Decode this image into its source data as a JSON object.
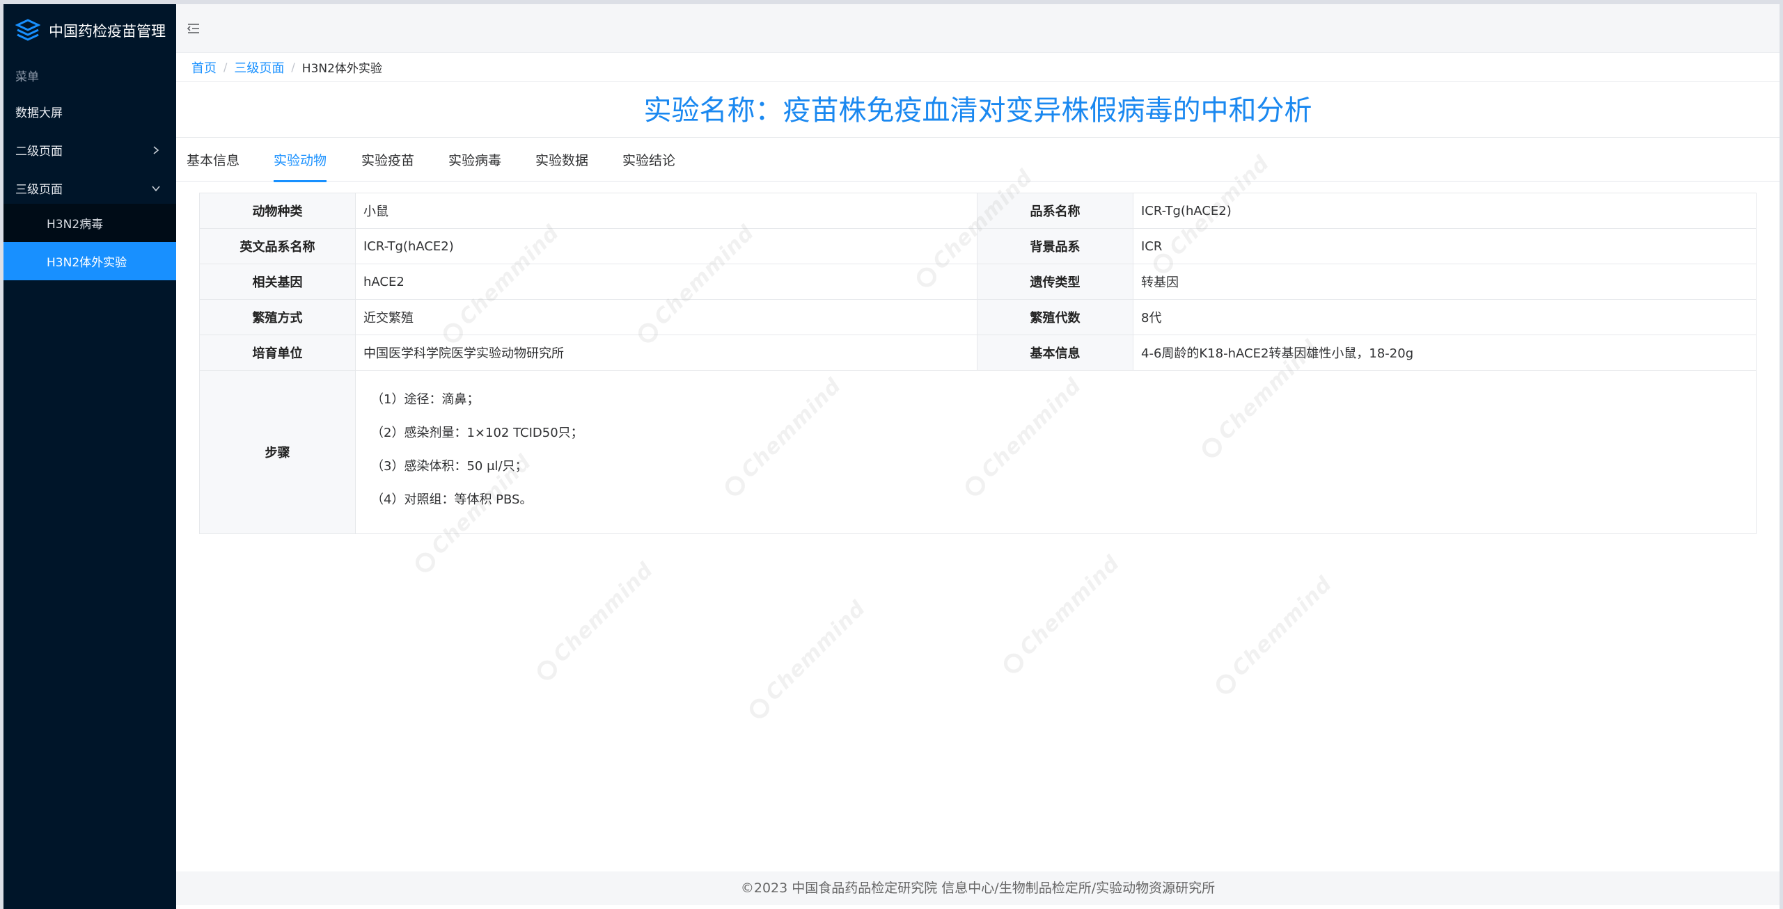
{
  "app": {
    "title": "中国药检疫苗管理"
  },
  "sidebar": {
    "caption": "菜单",
    "items": [
      {
        "label": "数据大屏"
      },
      {
        "label": "二级页面"
      },
      {
        "label": "三级页面"
      }
    ],
    "subitems": [
      {
        "label": "H3N2病毒"
      },
      {
        "label": "H3N2体外实验"
      }
    ]
  },
  "breadcrumb": [
    "首页",
    "三级页面",
    "H3N2体外实验"
  ],
  "page_title": "实验名称：疫苗株免疫血清对变异株假病毒的中和分析",
  "tabs": [
    "基本信息",
    "实验动物",
    "实验疫苗",
    "实验病毒",
    "实验数据",
    "实验结论"
  ],
  "active_tab": "实验动物",
  "table": {
    "rows": [
      {
        "l1": "动物种类",
        "v1": "小鼠",
        "l2": "品系名称",
        "v2": "ICR-Tg(hACE2)"
      },
      {
        "l1": "英文品系名称",
        "v1": "ICR-Tg(hACE2)",
        "l2": "背景品系",
        "v2": "ICR"
      },
      {
        "l1": "相关基因",
        "v1": "hACE2",
        "l2": "遗传类型",
        "v2": "转基因"
      },
      {
        "l1": "繁殖方式",
        "v1": "近交繁殖",
        "l2": "繁殖代数",
        "v2": "8代"
      },
      {
        "l1": "培育单位",
        "v1": "中国医学科学院医学实验动物研究所",
        "l2": "基本信息",
        "v2": "4-6周龄的K18-hACE2转基因雄性小鼠，18-20g"
      }
    ],
    "steps_label": "步骤",
    "steps": [
      "（1）途径：滴鼻；",
      "（2）感染剂量：1×102 TCID50只；",
      "（3）感染体积：50 μl/只；",
      "（4）对照组：等体积 PBS。"
    ]
  },
  "watermark": "Chemmind",
  "footer": "©2023 中国食品药品检定研究院 信息中心/生物制品检定所/实验动物资源研究所",
  "colors": {
    "sidebar_bg": "#001529",
    "accent": "#1890ff",
    "title": "#1a88f0"
  }
}
